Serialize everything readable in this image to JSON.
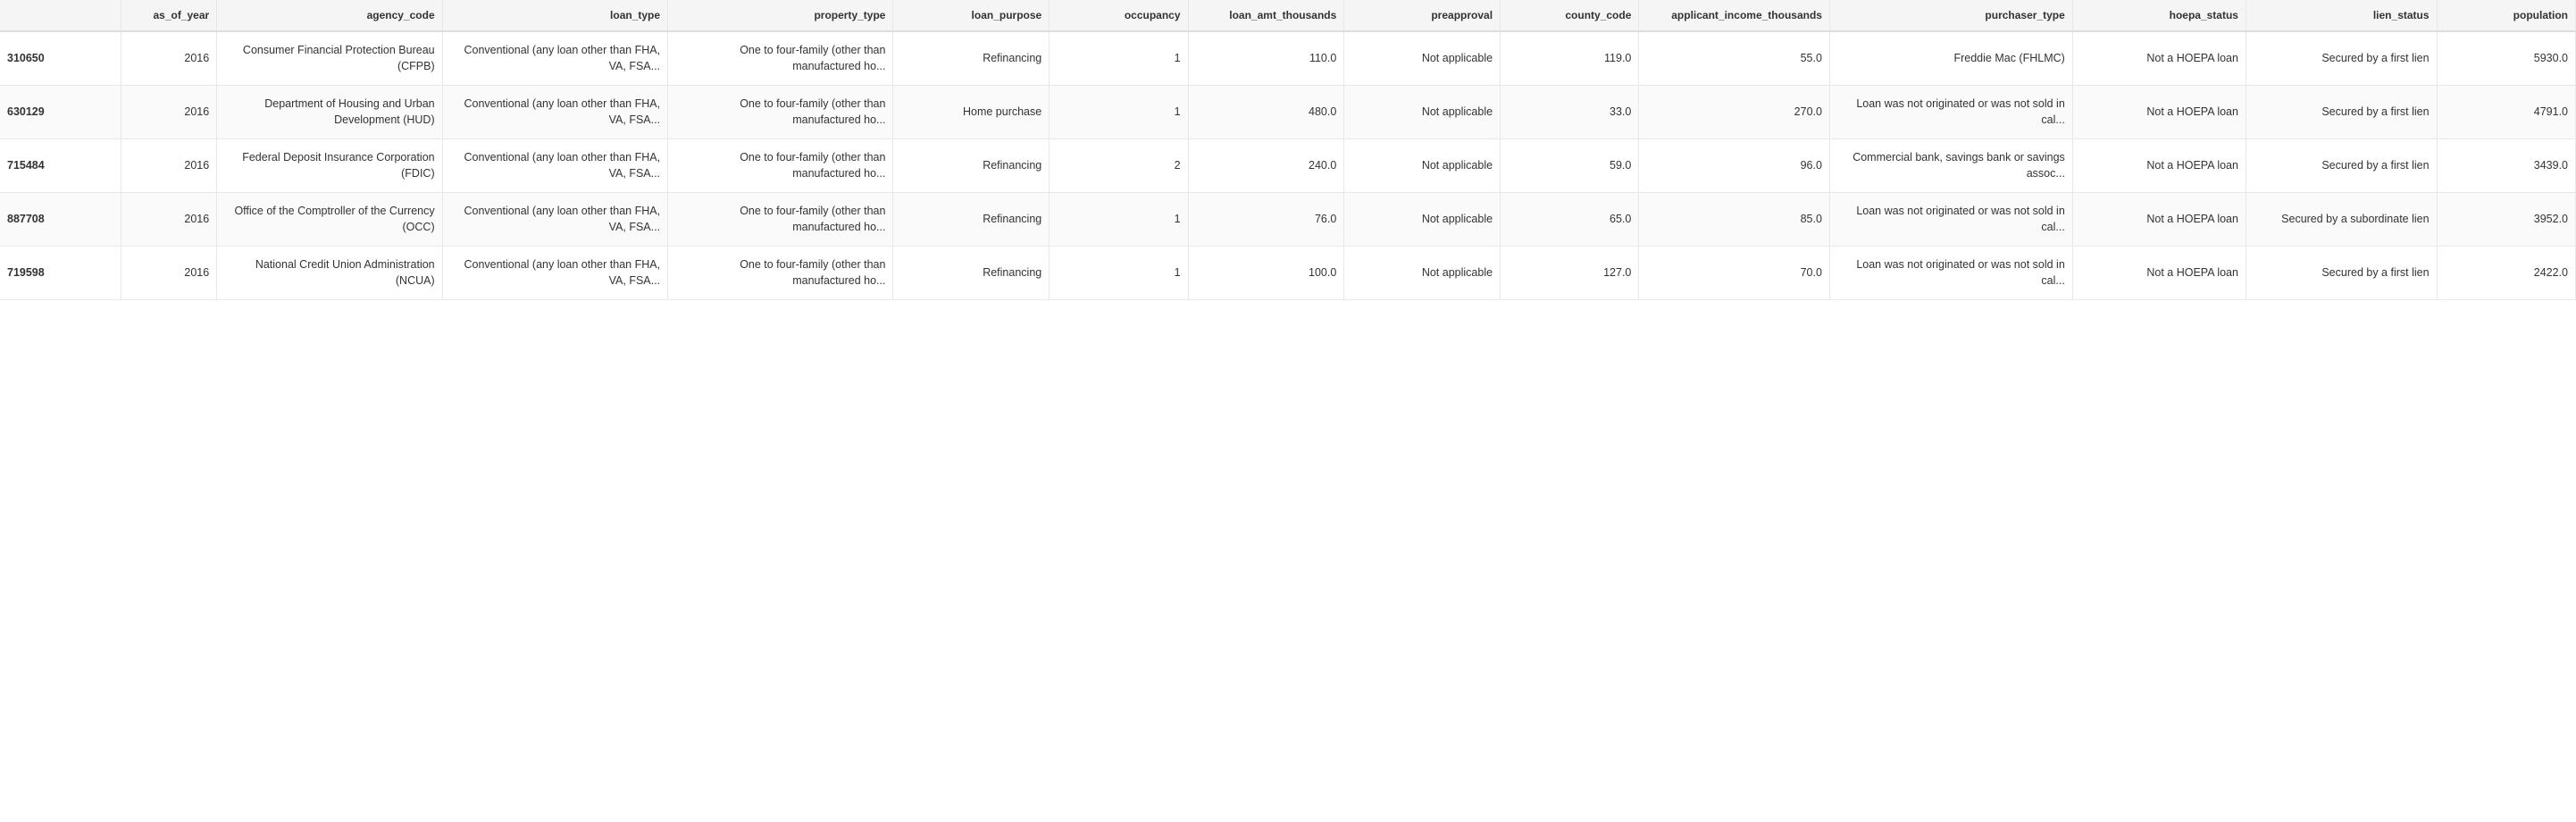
{
  "table": {
    "columns": [
      {
        "key": "id",
        "label": "",
        "class": "col-id"
      },
      {
        "key": "as_of_year",
        "label": "as_of_year",
        "class": "col-year"
      },
      {
        "key": "agency_code",
        "label": "agency_code",
        "class": "col-agency"
      },
      {
        "key": "loan_type",
        "label": "loan_type",
        "class": "col-loantype"
      },
      {
        "key": "property_type",
        "label": "property_type",
        "class": "col-proptype"
      },
      {
        "key": "loan_purpose",
        "label": "loan_purpose",
        "class": "col-purpose"
      },
      {
        "key": "occupancy",
        "label": "occupancy",
        "class": "col-occupancy"
      },
      {
        "key": "loan_amt_thousands",
        "label": "loan_amt_thousands",
        "class": "col-loanamt"
      },
      {
        "key": "preapproval",
        "label": "preapproval",
        "class": "col-preapproval"
      },
      {
        "key": "county_code",
        "label": "county_code",
        "class": "col-county"
      },
      {
        "key": "applicant_income_thousands",
        "label": "applicant_income_thousands",
        "class": "col-income"
      },
      {
        "key": "purchaser_type",
        "label": "purchaser_type",
        "class": "col-purchaser"
      },
      {
        "key": "hoepa_status",
        "label": "hoepa_status",
        "class": "col-hoepa"
      },
      {
        "key": "lien_status",
        "label": "lien_status",
        "class": "col-lien"
      },
      {
        "key": "population",
        "label": "population",
        "class": "col-population"
      }
    ],
    "rows": [
      {
        "id": "310650",
        "as_of_year": "2016",
        "agency_code": "Consumer Financial Protection Bureau (CFPB)",
        "loan_type": "Conventional (any loan other than FHA, VA, FSA...",
        "property_type": "One to four-family (other than manufactured ho...",
        "loan_purpose": "Refinancing",
        "occupancy": "1",
        "loan_amt_thousands": "110.0",
        "preapproval": "Not applicable",
        "county_code": "119.0",
        "applicant_income_thousands": "55.0",
        "purchaser_type": "Freddie Mac (FHLMC)",
        "hoepa_status": "Not a HOEPA loan",
        "lien_status": "Secured by a first lien",
        "population": "5930.0"
      },
      {
        "id": "630129",
        "as_of_year": "2016",
        "agency_code": "Department of Housing and Urban Development (HUD)",
        "loan_type": "Conventional (any loan other than FHA, VA, FSA...",
        "property_type": "One to four-family (other than manufactured ho...",
        "loan_purpose": "Home purchase",
        "occupancy": "1",
        "loan_amt_thousands": "480.0",
        "preapproval": "Not applicable",
        "county_code": "33.0",
        "applicant_income_thousands": "270.0",
        "purchaser_type": "Loan was not originated or was not sold in cal...",
        "hoepa_status": "Not a HOEPA loan",
        "lien_status": "Secured by a first lien",
        "population": "4791.0"
      },
      {
        "id": "715484",
        "as_of_year": "2016",
        "agency_code": "Federal Deposit Insurance Corporation (FDIC)",
        "loan_type": "Conventional (any loan other than FHA, VA, FSA...",
        "property_type": "One to four-family (other than manufactured ho...",
        "loan_purpose": "Refinancing",
        "occupancy": "2",
        "loan_amt_thousands": "240.0",
        "preapproval": "Not applicable",
        "county_code": "59.0",
        "applicant_income_thousands": "96.0",
        "purchaser_type": "Commercial bank, savings bank or savings assoc...",
        "hoepa_status": "Not a HOEPA loan",
        "lien_status": "Secured by a first lien",
        "population": "3439.0"
      },
      {
        "id": "887708",
        "as_of_year": "2016",
        "agency_code": "Office of the Comptroller of the Currency (OCC)",
        "loan_type": "Conventional (any loan other than FHA, VA, FSA...",
        "property_type": "One to four-family (other than manufactured ho...",
        "loan_purpose": "Refinancing",
        "occupancy": "1",
        "loan_amt_thousands": "76.0",
        "preapproval": "Not applicable",
        "county_code": "65.0",
        "applicant_income_thousands": "85.0",
        "purchaser_type": "Loan was not originated or was not sold in cal...",
        "hoepa_status": "Not a HOEPA loan",
        "lien_status": "Secured by a subordinate lien",
        "population": "3952.0"
      },
      {
        "id": "719598",
        "as_of_year": "2016",
        "agency_code": "National Credit Union Administration (NCUA)",
        "loan_type": "Conventional (any loan other than FHA, VA, FSA...",
        "property_type": "One to four-family (other than manufactured ho...",
        "loan_purpose": "Refinancing",
        "occupancy": "1",
        "loan_amt_thousands": "100.0",
        "preapproval": "Not applicable",
        "county_code": "127.0",
        "applicant_income_thousands": "70.0",
        "purchaser_type": "Loan was not originated or was not sold in cal...",
        "hoepa_status": "Not a HOEPA loan",
        "lien_status": "Secured by a first lien",
        "population": "2422.0"
      }
    ]
  }
}
